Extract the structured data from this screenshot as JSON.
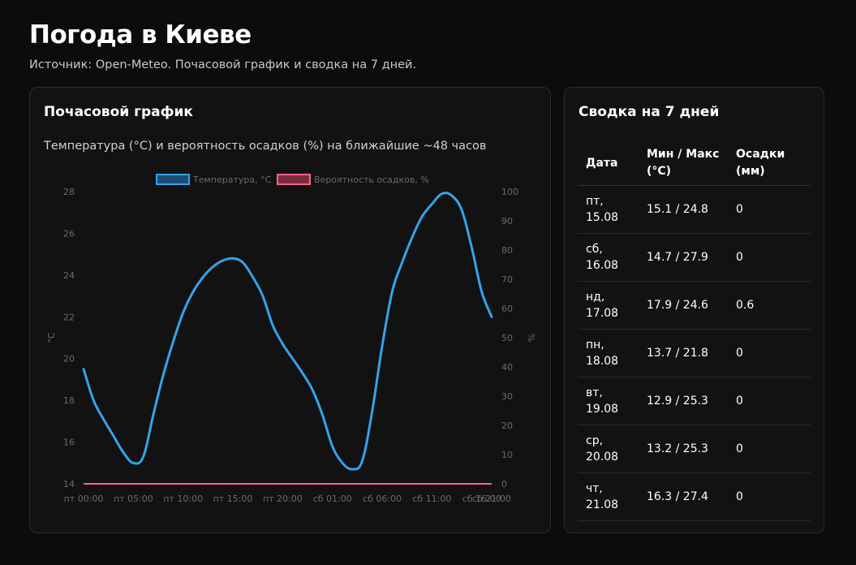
{
  "header": {
    "title": "Погода в Киеве",
    "subtitle": "Источник: Open-Meteo. Почасовой график и сводка на 7 дней."
  },
  "hourly_card": {
    "title": "Почасовой график",
    "description": "Температура (°C) и вероятность осадков (%) на ближайшие ~48 часов"
  },
  "summary_card": {
    "title": "Сводка на 7 дней",
    "columns": [
      "Дата",
      "Мин / Макс (°C)",
      "Осадки (мм)"
    ],
    "rows": [
      {
        "date": "пт,\n15.08",
        "minmax": "15.1 / 24.8",
        "precip": "0"
      },
      {
        "date": "сб,\n16.08",
        "minmax": "14.7 / 27.9",
        "precip": "0"
      },
      {
        "date": "нд,\n17.08",
        "minmax": "17.9 / 24.6",
        "precip": "0.6"
      },
      {
        "date": "пн,\n18.08",
        "minmax": "13.7 / 21.8",
        "precip": "0"
      },
      {
        "date": "вт,\n19.08",
        "minmax": "12.9 / 25.3",
        "precip": "0"
      },
      {
        "date": "ср,\n20.08",
        "minmax": "13.2 / 25.3",
        "precip": "0"
      },
      {
        "date": "чт,\n21.08",
        "minmax": "16.3 / 27.4",
        "precip": "0"
      }
    ]
  },
  "chart_data": {
    "type": "line",
    "xlabel": "",
    "ylabel": "°C",
    "y2label": "%",
    "ylim": [
      14,
      28
    ],
    "y2lim": [
      0,
      100
    ],
    "yticks": [
      14,
      16,
      18,
      20,
      22,
      24,
      26,
      28
    ],
    "y2ticks": [
      0,
      10,
      20,
      30,
      40,
      50,
      60,
      70,
      80,
      90,
      100
    ],
    "xtick_labels": [
      "пт 00:00",
      "пт 05:00",
      "пт 10:00",
      "пт 15:00",
      "пт 20:00",
      "сб 01:00",
      "сб 06:00",
      "сб 11:00",
      "сб 16:00",
      "сб 21:00"
    ],
    "legend_position": "top",
    "series": [
      {
        "name": "Температура, °C",
        "axis": "left",
        "color": "#36a2eb",
        "values": [
          19.5,
          18.0,
          17.1,
          16.3,
          15.5,
          15.0,
          15.3,
          17.3,
          19.2,
          20.8,
          22.2,
          23.2,
          23.9,
          24.4,
          24.7,
          24.8,
          24.6,
          23.9,
          23.0,
          21.6,
          20.7,
          20.0,
          19.3,
          18.5,
          17.3,
          15.8,
          15.0,
          14.7,
          15.1,
          17.5,
          20.6,
          23.2,
          24.6,
          25.8,
          26.8,
          27.4,
          27.9,
          27.8,
          27.1,
          25.3,
          23.2,
          22.0
        ]
      },
      {
        "name": "Вероятность осадков, %",
        "axis": "right",
        "color": "#ff6384",
        "values": [
          0,
          0,
          0,
          0,
          0,
          0,
          0,
          0,
          0,
          0,
          0,
          0,
          0,
          0,
          0,
          0,
          0,
          0,
          0,
          0,
          0,
          0,
          0,
          0,
          0,
          0,
          0,
          0,
          0,
          0,
          0,
          0,
          0,
          0,
          0,
          0,
          0,
          0,
          0,
          0,
          0,
          0
        ]
      }
    ]
  }
}
